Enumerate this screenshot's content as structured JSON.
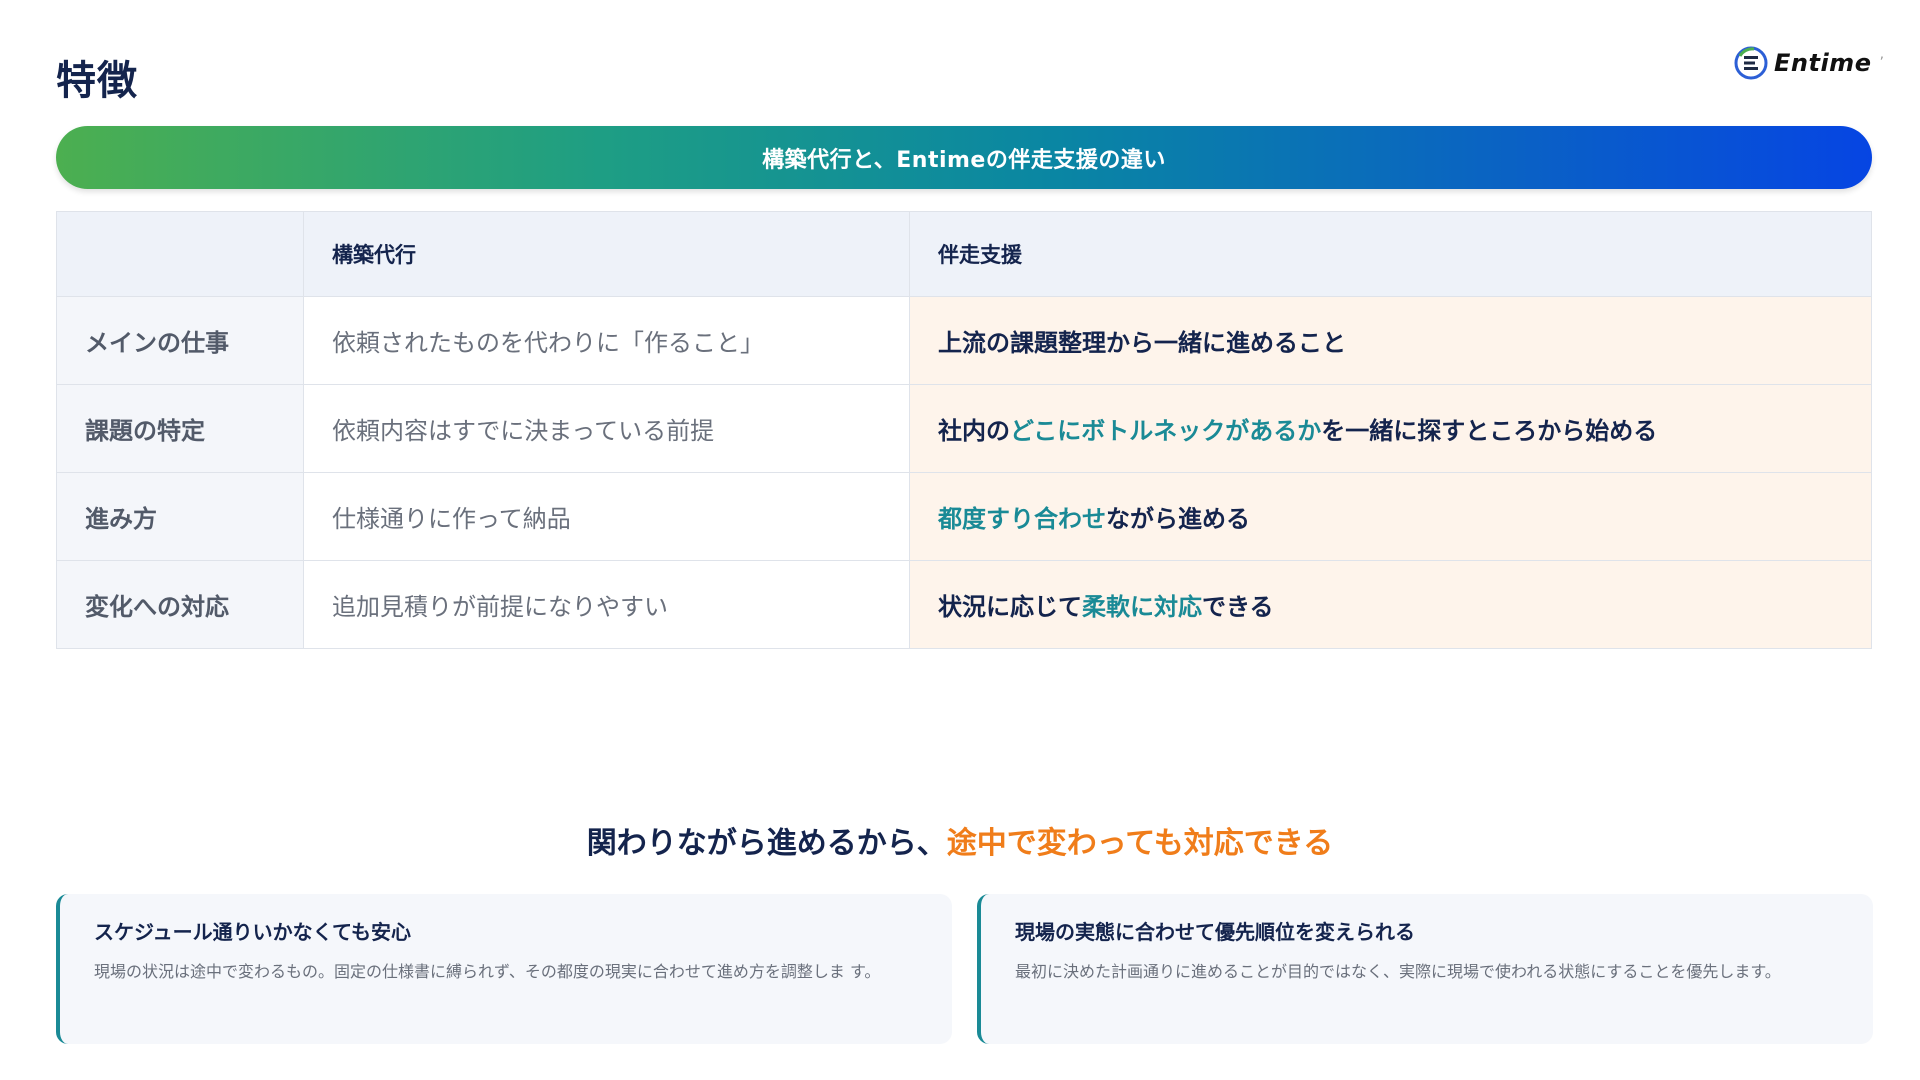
{
  "header": {
    "title": "特徴",
    "logo_text": "Entime",
    "logo_tick": "’"
  },
  "banner": {
    "text": "構築代行と、Entimeの伴走支援の違い"
  },
  "table": {
    "headers": [
      "",
      "構築代行",
      "伴走支援"
    ],
    "rows": [
      {
        "label": "メインの仕事",
        "build": "依頼されたものを代わりに「作ること」",
        "support": [
          {
            "text": "上流の課題整理から一緒に進めること",
            "highlight": false
          }
        ]
      },
      {
        "label": "課題の特定",
        "build": "依頼内容はすでに決まっている前提",
        "support": [
          {
            "text": "社内の",
            "highlight": false
          },
          {
            "text": "どこにボトルネックがあるか",
            "highlight": true
          },
          {
            "text": "を一緒に探すところから始める",
            "highlight": false
          }
        ]
      },
      {
        "label": "進み方",
        "build": "仕様通りに作って納品",
        "support": [
          {
            "text": "都度すり合わせ",
            "highlight": true
          },
          {
            "text": "ながら進める",
            "highlight": false
          }
        ]
      },
      {
        "label": "変化への対応",
        "build": "追加見積りが前提になりやすい",
        "support": [
          {
            "text": "状況に応じて",
            "highlight": false
          },
          {
            "text": "柔軟に対応",
            "highlight": true
          },
          {
            "text": "できる",
            "highlight": false
          }
        ]
      }
    ]
  },
  "section": {
    "heading_main": "関わりながら進めるから、",
    "heading_accent": "途中で変わっても対応できる"
  },
  "cards": [
    {
      "title": "スケジュール通りいかなくても安心",
      "body": "現場の状況は途中で変わるもの。固定の仕様書に縛られず、その都度の現実に合わせて進め方を調整しま す。"
    },
    {
      "title": "現場の実態に合わせて優先順位を変えられる",
      "body": "最初に決めた計画通りに進めることが目的ではなく、実際に現場で使われる状態にすることを優先します。"
    }
  ],
  "colors": {
    "navy": "#14244d",
    "teal_highlight": "#1a8a96",
    "orange_accent": "#f07d1a",
    "banner_gradient_start": "#4caf50",
    "banner_gradient_end": "#0645e3",
    "support_column_bg": "#fef4eb"
  }
}
